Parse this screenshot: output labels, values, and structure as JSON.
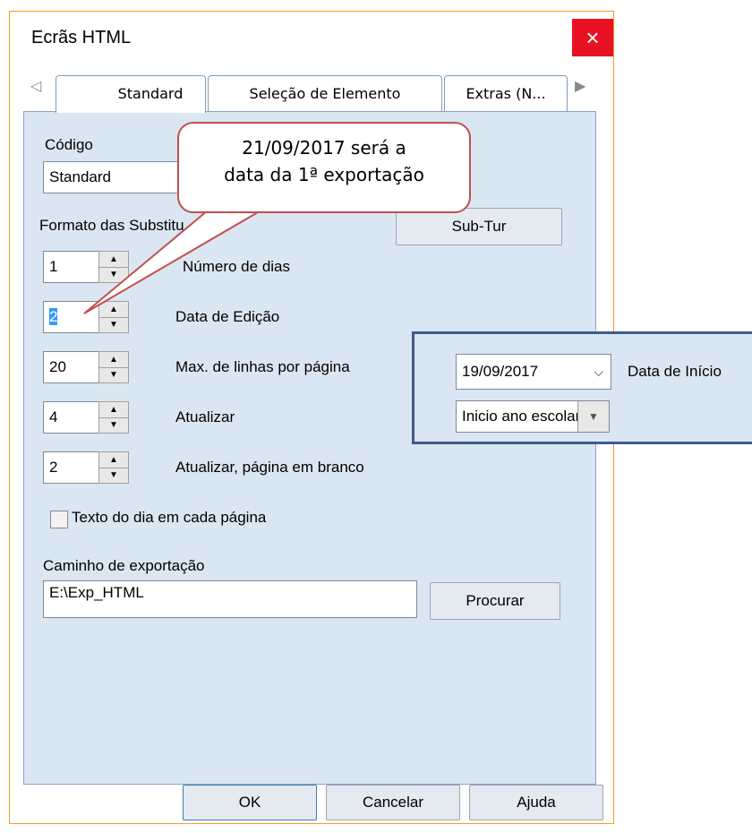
{
  "window": {
    "title": "Ecrãs HTML",
    "close_icon": "×"
  },
  "tabs": {
    "left_arrow": "◁",
    "right_arrow": "▶",
    "items": [
      {
        "label": "Standard",
        "active": true
      },
      {
        "label": "Seleção de Elemento",
        "active": false
      },
      {
        "label": "Extras (N...",
        "active": false
      }
    ]
  },
  "form": {
    "codigo_label": "Código",
    "codigo_value": "Standard",
    "formato_label": "Formato das Substitu",
    "subtur_button": "Sub-Tur",
    "spinners": [
      {
        "value": "1",
        "label": "Número de dias"
      },
      {
        "value": "2",
        "label": "Data de Edição"
      },
      {
        "value": "20",
        "label": "Max. de linhas por página"
      },
      {
        "value": "4",
        "label": "Atualizar"
      },
      {
        "value": "2",
        "label": "Atualizar, página em branco"
      }
    ],
    "checkbox_label": "Texto do dia em cada página",
    "caminho_label": "Caminho de exportação",
    "caminho_value": "E:\\Exp_HTML",
    "procurar_button": "Procurar"
  },
  "buttons": {
    "ok": "OK",
    "cancel": "Cancelar",
    "help": "Ajuda"
  },
  "callout": {
    "line1": "21/09/2017 será a",
    "line2": "data da 1ª exportação"
  },
  "overlay": {
    "date_value": "19/09/2017",
    "date_label": "Data de Início",
    "select_value": "Inicio ano escolar"
  },
  "colors": {
    "callout_border": "#c0504d",
    "close_bg": "#e81123",
    "overlay_border": "#3d5a90"
  }
}
